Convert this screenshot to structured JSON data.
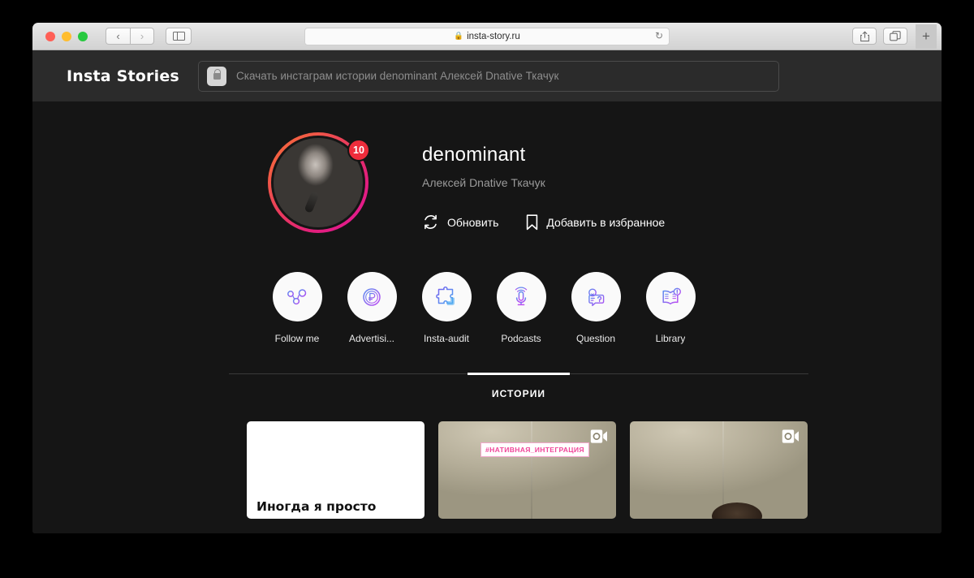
{
  "browser": {
    "url": "insta-story.ru",
    "lock_icon": "lock-icon",
    "back_label": "‹",
    "forward_label": "›",
    "reload_label": "↻",
    "new_tab_label": "+",
    "sidebar_icon": "sidebar-icon",
    "share_icon": "share-icon",
    "tabs_icon": "tabs-overview-icon"
  },
  "site": {
    "logo": "Insta Stories",
    "search": {
      "value": "Скачать инстаграм истории denominant Алексей Dnative Ткачук",
      "lock_icon": "lock-icon"
    }
  },
  "profile": {
    "username": "denominant",
    "fullname": "Алексей Dnative Ткачук",
    "story_count_badge": "10",
    "actions": [
      {
        "label": "Обновить",
        "icon": "refresh-icon"
      },
      {
        "label": "Добавить в избранное",
        "icon": "bookmark-icon"
      }
    ]
  },
  "highlights": [
    {
      "label": "Follow me",
      "icon": "network-share-icon"
    },
    {
      "label": "Advertisi...",
      "icon": "ruble-coin-icon"
    },
    {
      "label": "Insta-audit",
      "icon": "puzzle-icon"
    },
    {
      "label": "Podcasts",
      "icon": "microphone-icon"
    },
    {
      "label": "Question",
      "icon": "chat-question-icon"
    },
    {
      "label": "Library",
      "icon": "book-alert-icon"
    }
  ],
  "tabs": [
    {
      "label": "ИСТОРИИ",
      "active": true
    }
  ],
  "stories": [
    {
      "kind": "image",
      "title": "Иногда я просто",
      "hashtag": "",
      "has_video": false
    },
    {
      "kind": "video",
      "title": "",
      "hashtag": "#НАТИВНАЯ_ИНТЕГРАЦИЯ",
      "has_video": true
    },
    {
      "kind": "video",
      "title": "",
      "hashtag": "",
      "has_video": true
    }
  ],
  "colors": {
    "page_bg": "#151515",
    "header_bg": "#2b2b2b",
    "accent_badge": "#ed2c3b",
    "ring_start": "#f9703a",
    "ring_end": "#e5179a",
    "hashtag_pink": "#f0469a"
  }
}
